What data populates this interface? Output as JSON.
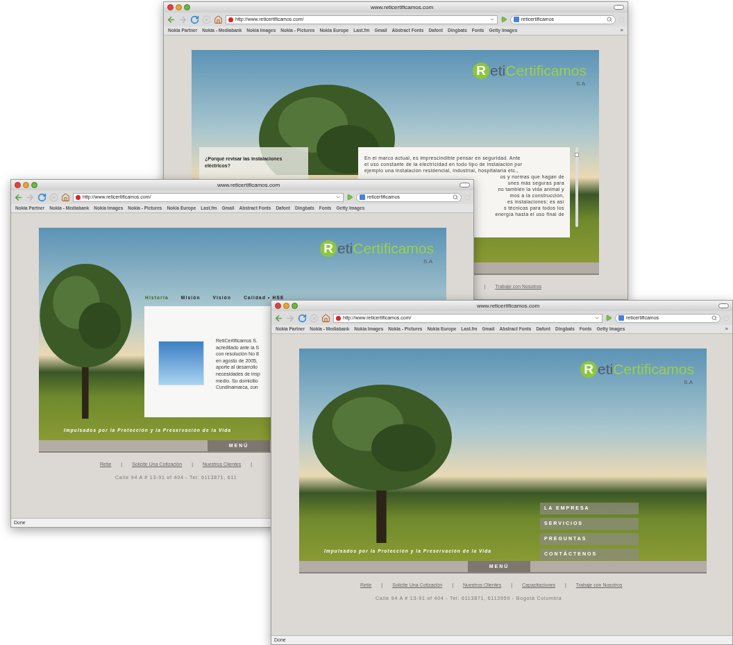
{
  "windows": [
    {
      "title": "www.reticertificamos.com",
      "url": "http://www.reticertificamos.com/",
      "search": "reticertificamos",
      "bookmarks": [
        "Nokia Partner",
        "Nokia - Mediabank",
        "Nokia Images",
        "Nokia - Pictures",
        "Nokia Europe",
        "Last.fm",
        "Gmail",
        "Abstract Fonts",
        "Dafont",
        "Dingbats",
        "Fonts",
        "Getty Images"
      ],
      "more": "»",
      "page": {
        "logo": {
          "initial": "R",
          "part1": "eti",
          "part2": "Certificamos",
          "suffix": "S.A"
        },
        "question": "¿Porqué revisar las instalaciones eléctricos?",
        "article": {
          "lines": [
            "En el marco actual, es imprescindible pensar en seguridad.  Ante",
            "el uso constante de la electricidad en todo tipo de instalación por",
            "ejemplo una instalación residencial, industrial, hospitalaria etc.,"
          ],
          "clipped_lines": [
            "os y normas que hagan de",
            "ones más seguras para",
            "no también la vida animal y",
            "mos a la construcción,",
            "es instalaciones; es así",
            "s técnicas para todos los",
            "energía hasta el uso final de"
          ]
        },
        "footer": [
          {
            "kind": "separator",
            "text": "|"
          },
          {
            "kind": "link",
            "text": "Trabaje con Nosotros"
          }
        ]
      }
    },
    {
      "title": "www.reticertificamos.com",
      "url": "http://www.reticertificamos.com/",
      "search": "reticertificamos",
      "bookmarks": [
        "Nokia Partner",
        "Nokia - Mediabank",
        "Nokia Images",
        "Nokia - Pictures",
        "Nokia Europe",
        "Last.fm",
        "Gmail",
        "Abstract Fonts",
        "Dafont",
        "Dingbats",
        "Fonts",
        "Getty Images"
      ],
      "page": {
        "logo": {
          "initial": "R",
          "part1": "eti",
          "part2": "Certificamos",
          "suffix": "S.A"
        },
        "nav": [
          {
            "label": "Historia",
            "selected": true
          },
          {
            "label": "Misión",
            "selected": false
          },
          {
            "label": "Visión",
            "selected": false
          },
          {
            "label": "Calidad • HSE",
            "selected": false
          }
        ],
        "about": {
          "lines": [
            "RetiCertificamos S.",
            "acreditado ante la S",
            "con resolución No 8",
            "en agosto de 2005,",
            "aporte al desarrollo",
            "necesidades de insp",
            "medio. Su domicilio",
            "Cundinamarca, con"
          ]
        },
        "slogan": "Impulsados por la Protección y la Preservación de la Vida",
        "menu_label": "MENÚ",
        "footer": [
          {
            "kind": "link",
            "text": "Retie"
          },
          {
            "kind": "separator",
            "text": "|"
          },
          {
            "kind": "link",
            "text": "Solicite Una Cotización"
          },
          {
            "kind": "separator",
            "text": "|"
          },
          {
            "kind": "link",
            "text": "Nuestros Clientes"
          },
          {
            "kind": "separator",
            "text": "|"
          }
        ],
        "address": "Calle 94 A # 13-91 of 404 - Tel: 6113871, 611"
      },
      "status": "Done"
    },
    {
      "title": "www.reticertificamos.com",
      "url": "http://www.reticertificamos.com/",
      "search": "reticertificamos",
      "bookmarks": [
        "Nokia Partner",
        "Nokia - Mediabank",
        "Nokia Images",
        "Nokia - Pictures",
        "Nokia Europe",
        "Last.fm",
        "Gmail",
        "Abstract Fonts",
        "Dafont",
        "Dingbats",
        "Fonts",
        "Getty Images"
      ],
      "more": "»",
      "page": {
        "logo": {
          "initial": "R",
          "part1": "eti",
          "part2": "Certificamos",
          "suffix": "S.A"
        },
        "menu": [
          "LA EMPRESA",
          "SERVICIOS",
          "PREGUNTAS",
          "CONTÁCTENOS"
        ],
        "slogan": "Impulsados por la Protección y la Preservación de la Vida",
        "menu_label": "MENÚ",
        "footer": [
          {
            "kind": "link",
            "text": "Retie"
          },
          {
            "kind": "separator",
            "text": "|"
          },
          {
            "kind": "link",
            "text": "Solicite Una Cotización"
          },
          {
            "kind": "separator",
            "text": "|"
          },
          {
            "kind": "link",
            "text": "Nuestros Clientes"
          },
          {
            "kind": "separator",
            "text": "|"
          },
          {
            "kind": "link",
            "text": "Capacitaciones"
          },
          {
            "kind": "separator",
            "text": "|"
          },
          {
            "kind": "link",
            "text": "Trabaje con Nosotros"
          }
        ],
        "address": "Calle 94 A # 13-91 of 404 - Tel: 6113871, 6113959 - Bogotá Colombia"
      },
      "status": "Done"
    }
  ]
}
